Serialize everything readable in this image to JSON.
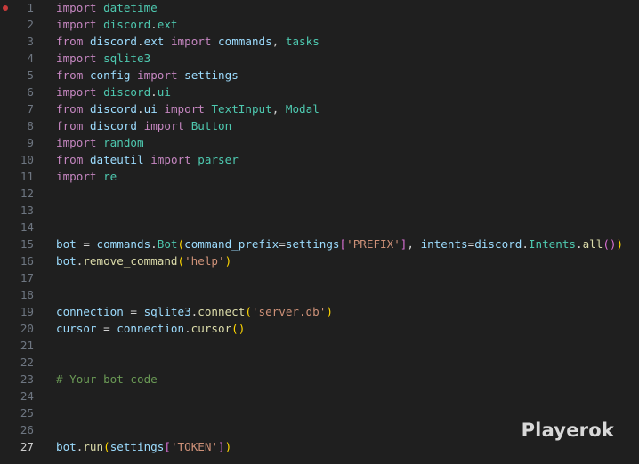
{
  "editor": {
    "language": "python",
    "active_line": 27,
    "breakpoint_line": 1,
    "lines": [
      {
        "n": "1",
        "tokens": [
          [
            "kw",
            "import"
          ],
          [
            "op",
            " "
          ],
          [
            "mod",
            "datetime"
          ]
        ]
      },
      {
        "n": "2",
        "tokens": [
          [
            "kw",
            "import"
          ],
          [
            "op",
            " "
          ],
          [
            "mod",
            "discord"
          ],
          [
            "op",
            "."
          ],
          [
            "mod",
            "ext"
          ]
        ]
      },
      {
        "n": "3",
        "tokens": [
          [
            "kw",
            "from"
          ],
          [
            "op",
            " "
          ],
          [
            "var",
            "discord"
          ],
          [
            "op",
            "."
          ],
          [
            "var",
            "ext"
          ],
          [
            "op",
            " "
          ],
          [
            "kw",
            "import"
          ],
          [
            "op",
            " "
          ],
          [
            "var",
            "commands"
          ],
          [
            "op",
            ", "
          ],
          [
            "mod",
            "tasks"
          ]
        ]
      },
      {
        "n": "4",
        "tokens": [
          [
            "kw",
            "import"
          ],
          [
            "op",
            " "
          ],
          [
            "mod",
            "sqlite3"
          ]
        ]
      },
      {
        "n": "5",
        "tokens": [
          [
            "kw",
            "from"
          ],
          [
            "op",
            " "
          ],
          [
            "var",
            "config"
          ],
          [
            "op",
            " "
          ],
          [
            "kw",
            "import"
          ],
          [
            "op",
            " "
          ],
          [
            "var",
            "settings"
          ]
        ]
      },
      {
        "n": "6",
        "tokens": [
          [
            "kw",
            "import"
          ],
          [
            "op",
            " "
          ],
          [
            "mod",
            "discord"
          ],
          [
            "op",
            "."
          ],
          [
            "mod",
            "ui"
          ]
        ]
      },
      {
        "n": "7",
        "tokens": [
          [
            "kw",
            "from"
          ],
          [
            "op",
            " "
          ],
          [
            "var",
            "discord"
          ],
          [
            "op",
            "."
          ],
          [
            "var",
            "ui"
          ],
          [
            "op",
            " "
          ],
          [
            "kw",
            "import"
          ],
          [
            "op",
            " "
          ],
          [
            "mod",
            "TextInput"
          ],
          [
            "op",
            ", "
          ],
          [
            "mod",
            "Modal"
          ]
        ]
      },
      {
        "n": "8",
        "tokens": [
          [
            "kw",
            "from"
          ],
          [
            "op",
            " "
          ],
          [
            "var",
            "discord"
          ],
          [
            "op",
            " "
          ],
          [
            "kw",
            "import"
          ],
          [
            "op",
            " "
          ],
          [
            "mod",
            "Button"
          ]
        ]
      },
      {
        "n": "9",
        "tokens": [
          [
            "kw",
            "import"
          ],
          [
            "op",
            " "
          ],
          [
            "mod",
            "random"
          ]
        ]
      },
      {
        "n": "10",
        "tokens": [
          [
            "kw",
            "from"
          ],
          [
            "op",
            " "
          ],
          [
            "var",
            "dateutil"
          ],
          [
            "op",
            " "
          ],
          [
            "kw",
            "import"
          ],
          [
            "op",
            " "
          ],
          [
            "mod",
            "parser"
          ]
        ]
      },
      {
        "n": "11",
        "tokens": [
          [
            "kw",
            "import"
          ],
          [
            "op",
            " "
          ],
          [
            "mod",
            "re"
          ]
        ]
      },
      {
        "n": "12",
        "tokens": []
      },
      {
        "n": "13",
        "tokens": []
      },
      {
        "n": "14",
        "tokens": []
      },
      {
        "n": "15",
        "tokens": [
          [
            "var",
            "bot"
          ],
          [
            "op",
            " = "
          ],
          [
            "var",
            "commands"
          ],
          [
            "op",
            "."
          ],
          [
            "mod",
            "Bot"
          ],
          [
            "p1",
            "("
          ],
          [
            "var",
            "command_prefix"
          ],
          [
            "op",
            "="
          ],
          [
            "var",
            "settings"
          ],
          [
            "p2",
            "["
          ],
          [
            "str",
            "'PREFIX'"
          ],
          [
            "p2",
            "]"
          ],
          [
            "op",
            ", "
          ],
          [
            "var",
            "intents"
          ],
          [
            "op",
            "="
          ],
          [
            "var",
            "discord"
          ],
          [
            "op",
            "."
          ],
          [
            "mod",
            "Intents"
          ],
          [
            "op",
            "."
          ],
          [
            "fn",
            "all"
          ],
          [
            "p2",
            "()"
          ],
          [
            "p1",
            ")"
          ]
        ]
      },
      {
        "n": "16",
        "tokens": [
          [
            "var",
            "bot"
          ],
          [
            "op",
            "."
          ],
          [
            "fn",
            "remove_command"
          ],
          [
            "p1",
            "("
          ],
          [
            "str",
            "'help'"
          ],
          [
            "p1",
            ")"
          ]
        ]
      },
      {
        "n": "17",
        "tokens": []
      },
      {
        "n": "18",
        "tokens": []
      },
      {
        "n": "19",
        "tokens": [
          [
            "var",
            "connection"
          ],
          [
            "op",
            " = "
          ],
          [
            "var",
            "sqlite3"
          ],
          [
            "op",
            "."
          ],
          [
            "fn",
            "connect"
          ],
          [
            "p1",
            "("
          ],
          [
            "str",
            "'server.db'"
          ],
          [
            "p1",
            ")"
          ]
        ]
      },
      {
        "n": "20",
        "tokens": [
          [
            "var",
            "cursor"
          ],
          [
            "op",
            " = "
          ],
          [
            "var",
            "connection"
          ],
          [
            "op",
            "."
          ],
          [
            "fn",
            "cursor"
          ],
          [
            "p1",
            "()"
          ]
        ]
      },
      {
        "n": "21",
        "tokens": []
      },
      {
        "n": "22",
        "tokens": []
      },
      {
        "n": "23",
        "tokens": [
          [
            "cm",
            "# Your bot code"
          ]
        ]
      },
      {
        "n": "24",
        "tokens": []
      },
      {
        "n": "25",
        "tokens": []
      },
      {
        "n": "26",
        "tokens": []
      },
      {
        "n": "27",
        "tokens": [
          [
            "var",
            "bot"
          ],
          [
            "op",
            "."
          ],
          [
            "fn",
            "run"
          ],
          [
            "p1",
            "("
          ],
          [
            "var",
            "settings"
          ],
          [
            "p2",
            "["
          ],
          [
            "str",
            "'TOKEN'"
          ],
          [
            "p2",
            "]"
          ],
          [
            "p1",
            ")"
          ]
        ]
      }
    ]
  },
  "watermark": "Playerok"
}
